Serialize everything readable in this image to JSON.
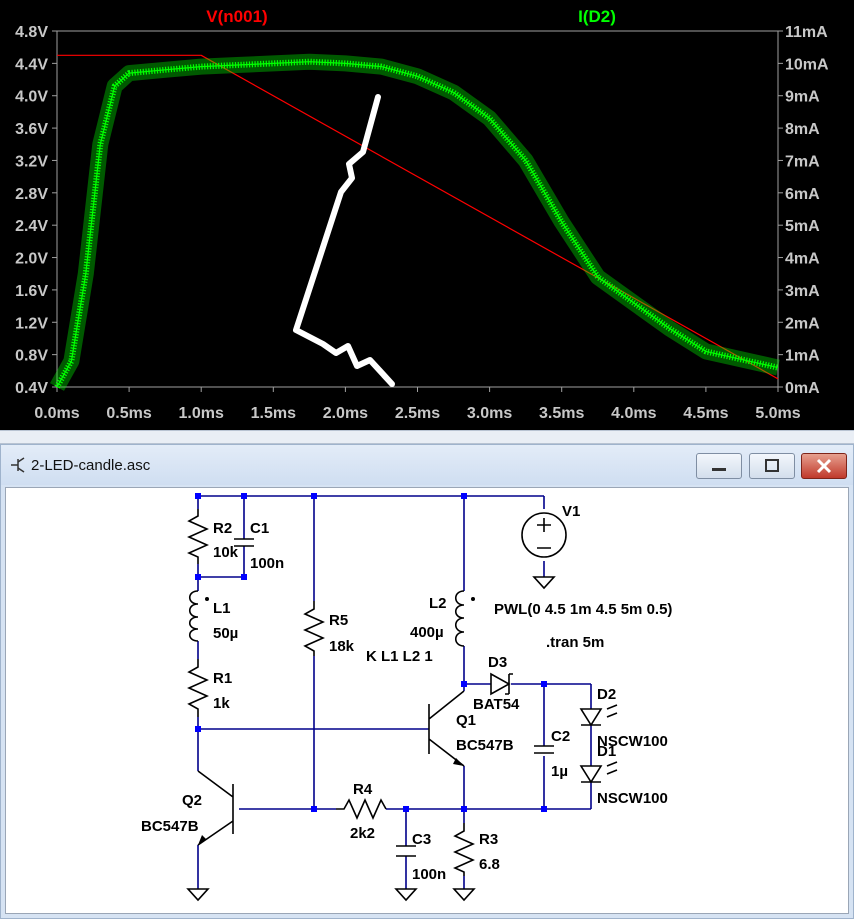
{
  "plot": {
    "trace_left": "V(n001)",
    "trace_right": "I(D2)",
    "trace_left_color": "#ff0000",
    "trace_right_color": "#00ff00",
    "left_ticks": [
      "4.8V",
      "4.4V",
      "4.0V",
      "3.6V",
      "3.2V",
      "2.8V",
      "2.4V",
      "2.0V",
      "1.6V",
      "1.2V",
      "0.8V",
      "0.4V"
    ],
    "right_ticks": [
      "11mA",
      "10mA",
      "9mA",
      "8mA",
      "7mA",
      "6mA",
      "5mA",
      "4mA",
      "3mA",
      "2mA",
      "1mA",
      "0mA"
    ],
    "x_ticks": [
      "0.0ms",
      "0.5ms",
      "1.0ms",
      "1.5ms",
      "2.0ms",
      "2.5ms",
      "3.0ms",
      "3.5ms",
      "4.0ms",
      "4.5ms",
      "5.0ms"
    ]
  },
  "chart_data": {
    "type": "line",
    "xlabel": "",
    "ylabel": "",
    "xlim": [
      0,
      5
    ],
    "ylim": [
      0.4,
      4.8
    ],
    "y2lim": [
      0,
      11
    ],
    "grid": false,
    "series": [
      {
        "name": "V(n001)",
        "axis": "left",
        "color": "#ff0000",
        "x": [
          0,
          1.0,
          5.0
        ],
        "y": [
          4.5,
          4.5,
          0.5
        ]
      },
      {
        "name": "I(D2)",
        "axis": "right",
        "color": "#00ff00",
        "x": [
          0,
          0.1,
          0.2,
          0.3,
          0.4,
          0.5,
          0.75,
          1.0,
          1.25,
          1.5,
          1.75,
          2.0,
          2.25,
          2.5,
          2.75,
          3.0,
          3.25,
          3.5,
          3.75,
          4.0,
          4.25,
          4.5,
          5.0
        ],
        "y": [
          0,
          0.8,
          3.5,
          7.5,
          9.3,
          9.7,
          9.8,
          9.9,
          9.95,
          10.0,
          10.05,
          10.0,
          9.9,
          9.6,
          9.1,
          8.3,
          7.0,
          5.1,
          3.4,
          2.6,
          1.8,
          1.1,
          0.6
        ]
      }
    ]
  },
  "window": {
    "title": "2-LED-candle.asc",
    "icon": "schematic-icon",
    "controls": [
      "minimize-icon",
      "maximize-icon",
      "close-icon"
    ]
  },
  "schematic": {
    "R2": {
      "name": "R2",
      "value": "10k"
    },
    "C1": {
      "name": "C1",
      "value": "100n"
    },
    "L1": {
      "name": "L1",
      "value": "50µ"
    },
    "R1": {
      "name": "R1",
      "value": "1k"
    },
    "R5": {
      "name": "R5",
      "value": "18k"
    },
    "L2": {
      "name": "L2",
      "value": "400µ"
    },
    "V1": {
      "name": "V1",
      "value": "PWL(0 4.5 1m 4.5 5m 0.5)"
    },
    "directive_tran": ".tran 5m",
    "directive_k": "K L1 L2 1",
    "D3": {
      "name": "D3",
      "value": "BAT54"
    },
    "Q1": {
      "name": "Q1",
      "value": "BC547B"
    },
    "C2": {
      "name": "C2",
      "value": "1µ"
    },
    "D2": {
      "name": "D2",
      "value": "NSCW100"
    },
    "D1": {
      "name": "D1",
      "value": "NSCW100"
    },
    "Q2": {
      "name": "Q2",
      "value": "BC547B"
    },
    "R4": {
      "name": "R4",
      "value": "2k2"
    },
    "C3": {
      "name": "C3",
      "value": "100n"
    },
    "R3": {
      "name": "R3",
      "value": "6.8"
    }
  }
}
